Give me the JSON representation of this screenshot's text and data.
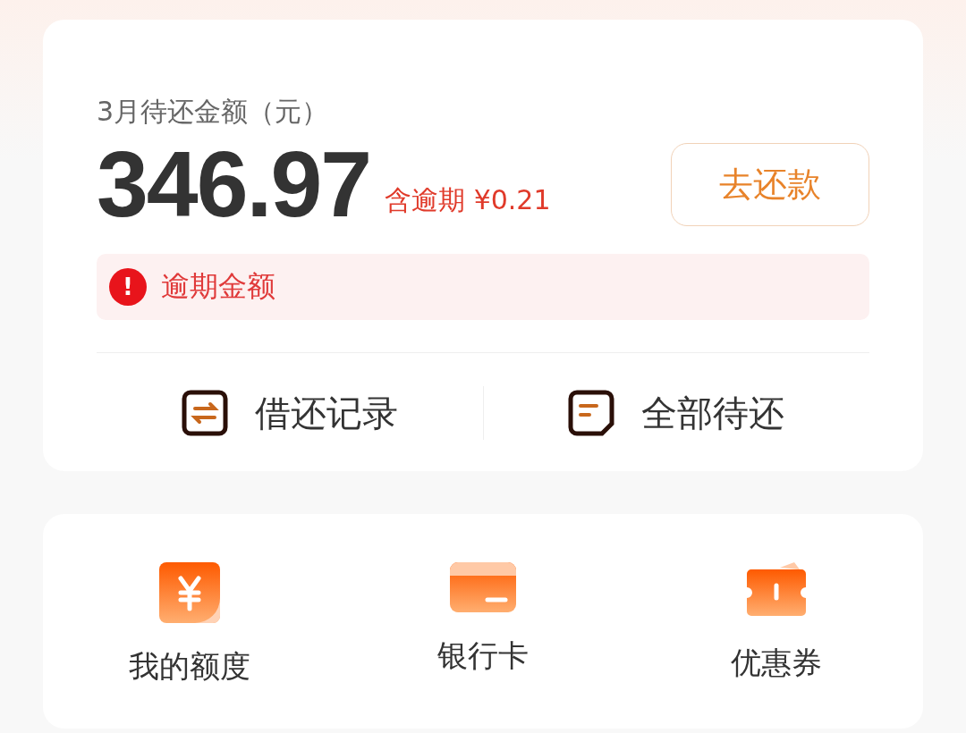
{
  "bill": {
    "title": "3月待还金额（元）",
    "amount": "346.97",
    "overdue_note": "含逾期 ¥0.21",
    "pay_button": "去还款",
    "alert": {
      "icon": "!",
      "text": "逾期金额"
    }
  },
  "links": [
    {
      "kind": "records",
      "label": "借还记录"
    },
    {
      "kind": "pending",
      "label": "全部待还"
    }
  ],
  "services": [
    {
      "kind": "quota",
      "label": "我的额度"
    },
    {
      "kind": "card",
      "label": "银行卡"
    },
    {
      "kind": "coupon",
      "label": "优惠券"
    }
  ]
}
